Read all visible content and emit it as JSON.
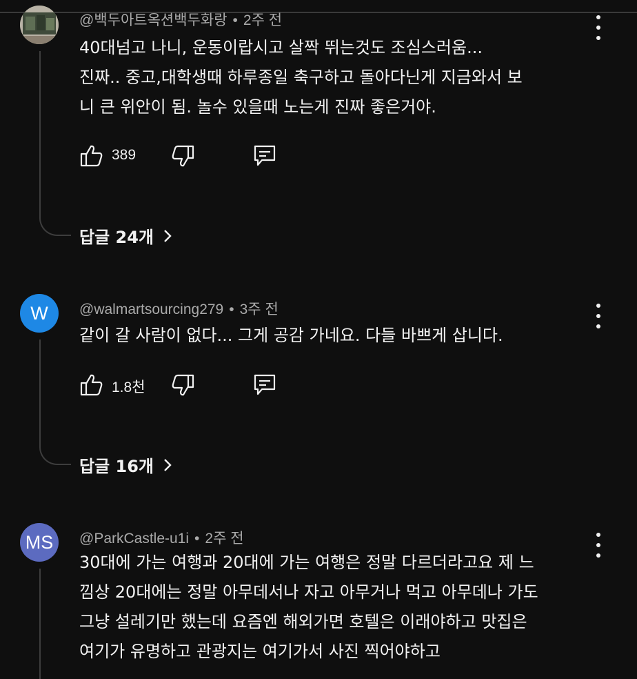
{
  "comments": [
    {
      "author": "@백두아트옥션백두화랑",
      "time": "2주 전",
      "avatar_letters": "",
      "avatar_color": "#5b6b4e",
      "text_lines": [
        "40대넘고 나니, 운동이랍시고 살짝 뛰는것도 조심스러움...",
        "진짜.. 중고,대학생때 하루종일 축구하고  돌아다닌게 지금와서 보",
        "니 큰 위안이 됨. 놀수 있을때 노는게 진짜 좋은거야."
      ],
      "likes": "389",
      "replies_label": "답글 24개"
    },
    {
      "author": "@walmartsourcing279",
      "time": "3주 전",
      "avatar_letters": "W",
      "avatar_color": "#1e88e5",
      "text_lines": [
        "같이 갈 사람이 없다... 그게 공감 가네요. 다들 바쁘게 삽니다."
      ],
      "likes": "1.8천",
      "replies_label": "답글 16개"
    },
    {
      "author": "@ParkCastle-u1i",
      "time": "2주 전",
      "avatar_letters": "MS",
      "avatar_color": "#5c6bc0",
      "text_lines": [
        "30대에 가는 여행과 20대에 가는 여행은 정말 다르더라고요 제 느",
        "낌상 20대에는 정말 아무데서나 자고 아무거나 먹고 아무데나 가도",
        "그냥 설레기만 했는데 요즘엔 해외가면 호텔은 이래야하고 맛집은",
        "여기가 유명하고 관광지는 여기가서 사진 찍어야하고"
      ]
    }
  ]
}
